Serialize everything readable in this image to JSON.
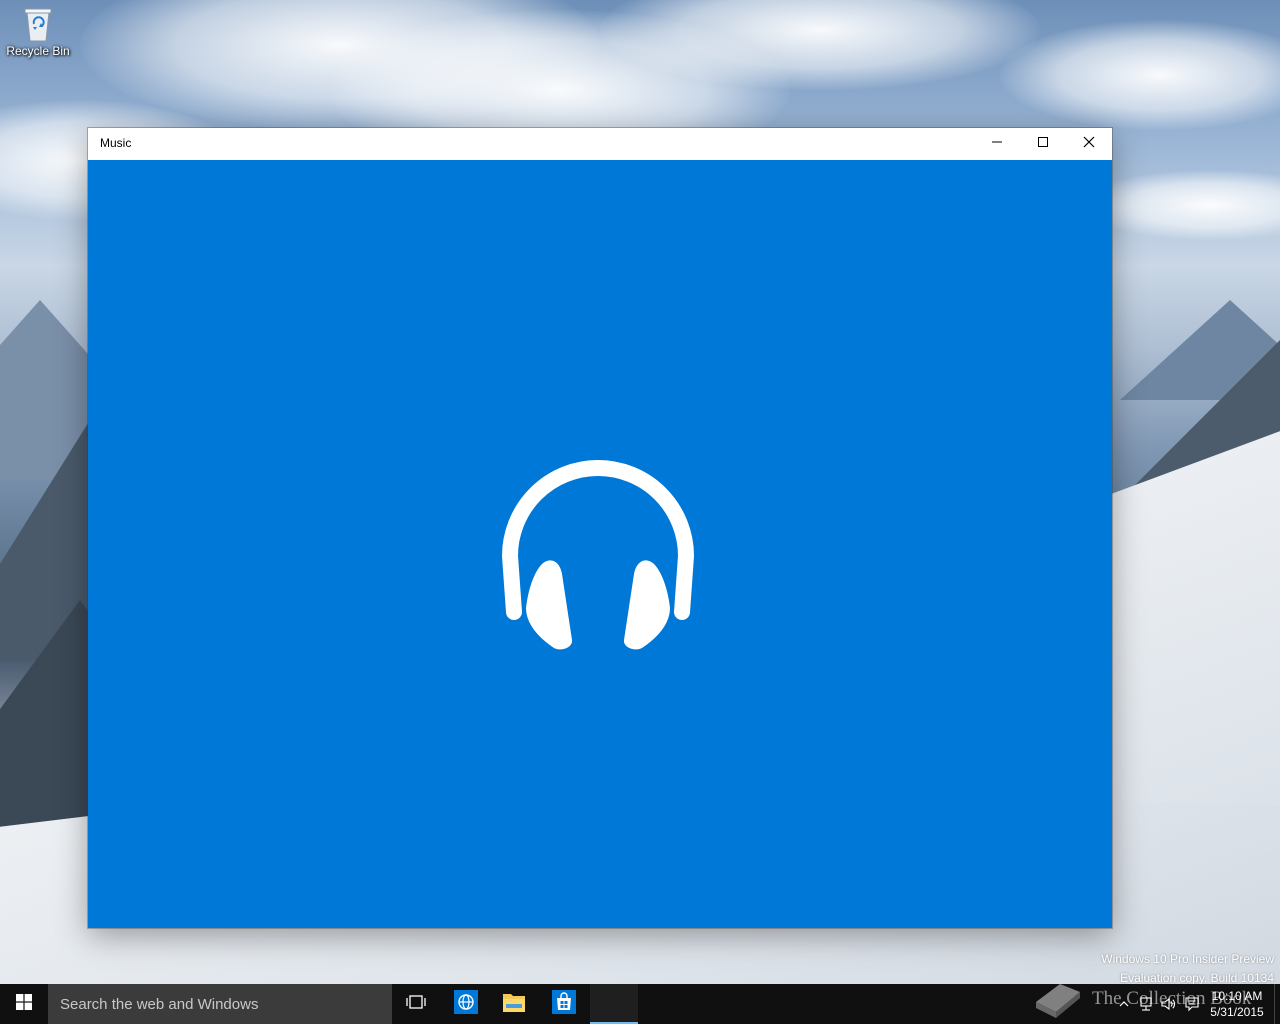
{
  "desktop": {
    "icons": [
      {
        "label": "Recycle Bin",
        "icon": "recycle-bin-icon"
      }
    ]
  },
  "window": {
    "title": "Music",
    "content_icon": "headphones-icon",
    "accent_color": "#0078d7",
    "controls": {
      "minimize": "minimize-icon",
      "maximize": "maximize-icon",
      "close": "close-icon"
    }
  },
  "watermark": {
    "line1": "Windows 10 Pro Insider Preview",
    "line2": "Evaluation copy. Build 10134"
  },
  "taskbar": {
    "search_placeholder": "Search the web and Windows",
    "apps": [
      {
        "name": "Task View",
        "icon": "task-view-icon"
      },
      {
        "name": "Edge",
        "icon": "globe-icon"
      },
      {
        "name": "File Explorer",
        "icon": "folder-icon"
      },
      {
        "name": "Store",
        "icon": "store-icon"
      },
      {
        "name": "Music",
        "icon": "music-app-icon",
        "active": true
      }
    ],
    "tray": {
      "time": "10:10 AM",
      "date": "5/31/2015",
      "icons": [
        "chevron-up-icon",
        "network-icon",
        "volume-icon",
        "action-center-icon"
      ]
    }
  },
  "overlay": {
    "brand_text": "The Collection Book"
  }
}
